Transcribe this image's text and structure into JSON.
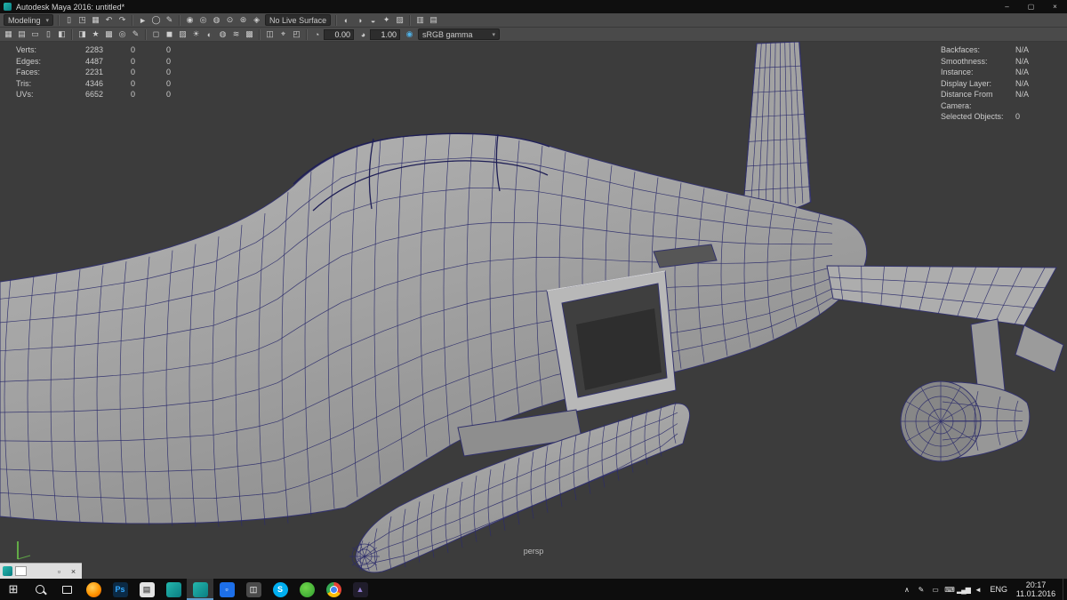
{
  "colors": {
    "maya_teal": "#14a09a",
    "viewport_bg": "#3c3c3c",
    "wireframe_blue": "#2b2b6a",
    "model_gray": "#a6a6a6",
    "chrome_bg": "#4a4a4a",
    "taskbar_bg": "#0d0d0d"
  },
  "glyphs": {
    "chevron_down": "▾"
  },
  "title_bar": {
    "title": "Autodesk Maya 2016: untitled*",
    "buttons": [
      {
        "name": "minimize-button",
        "glyph": "–"
      },
      {
        "name": "maximize-button",
        "glyph": "▢"
      },
      {
        "name": "close-button",
        "glyph": "×"
      }
    ]
  },
  "menubar": {
    "mode_selector": "Modeling",
    "live_surface": "No Live Surface",
    "file_icons": [
      {
        "name": "new-scene-icon",
        "glyph": "▯"
      },
      {
        "name": "open-scene-icon",
        "glyph": "◳"
      },
      {
        "name": "save-scene-icon",
        "glyph": "▦"
      }
    ],
    "history_icons": [
      {
        "name": "undo-icon",
        "glyph": "↶"
      },
      {
        "name": "redo-icon",
        "glyph": "↷"
      }
    ],
    "select_icons": [
      {
        "name": "select-tool-icon",
        "glyph": "►"
      },
      {
        "name": "lasso-select-icon",
        "glyph": "◯"
      },
      {
        "name": "paint-select-icon",
        "glyph": "✎"
      }
    ],
    "snap_icons": [
      {
        "name": "snap-to-grid-icon",
        "glyph": "◉"
      },
      {
        "name": "snap-to-curve-icon",
        "glyph": "◎"
      },
      {
        "name": "snap-to-point-icon",
        "glyph": "◍"
      },
      {
        "name": "snap-to-projected-center-icon",
        "glyph": "⊙"
      },
      {
        "name": "snap-to-view-plane-icon",
        "glyph": "⊛"
      },
      {
        "name": "make-object-live-icon",
        "glyph": "◈"
      }
    ],
    "render_icons": [
      {
        "name": "open-render-view-icon",
        "glyph": "◐"
      },
      {
        "name": "render-current-frame-icon",
        "glyph": "◑"
      },
      {
        "name": "ipr-render-icon",
        "glyph": "◒"
      },
      {
        "name": "render-settings-icon",
        "glyph": "✦"
      },
      {
        "name": "render-setup-icon",
        "glyph": "▨"
      }
    ],
    "panel_icons": [
      {
        "name": "toggle-panel-menus-icon",
        "glyph": "▥"
      },
      {
        "name": "toggle-toolbox-icon",
        "glyph": "▤"
      }
    ]
  },
  "toolbar2": {
    "display_icons": [
      {
        "name": "grid-toggle-icon",
        "glyph": "▦"
      },
      {
        "name": "heads-up-display-icon",
        "glyph": "▤"
      },
      {
        "name": "film-gate-icon",
        "glyph": "▭"
      },
      {
        "name": "resolution-gate-icon",
        "glyph": "▯"
      },
      {
        "name": "gate-mask-icon",
        "glyph": "◧"
      }
    ],
    "camera_icons": [
      {
        "name": "camera-attributes-icon",
        "glyph": "◨"
      },
      {
        "name": "bookmarks-icon",
        "glyph": "★"
      },
      {
        "name": "image-plane-icon",
        "glyph": "▩"
      },
      {
        "name": "pan-zoom-icon",
        "glyph": "◎"
      },
      {
        "name": "grease-pencil-icon",
        "glyph": "✎"
      }
    ],
    "shading_icons": [
      {
        "name": "wireframe-display-icon",
        "glyph": "◻"
      },
      {
        "name": "smooth-shade-icon",
        "glyph": "◼"
      },
      {
        "name": "textured-display-icon",
        "glyph": "▨"
      },
      {
        "name": "use-all-lights-icon",
        "glyph": "☀"
      },
      {
        "name": "shadows-icon",
        "glyph": "◐"
      },
      {
        "name": "screen-space-ao-icon",
        "glyph": "◍"
      },
      {
        "name": "motion-blur-icon",
        "glyph": "≋"
      },
      {
        "name": "anti-aliasing-icon",
        "glyph": "▩"
      }
    ],
    "isolate_icons": [
      {
        "name": "xray-display-icon",
        "glyph": "◫"
      },
      {
        "name": "xray-joints-icon",
        "glyph": "⌖"
      },
      {
        "name": "isolate-select-icon",
        "glyph": "◰"
      }
    ],
    "exposure_field": {
      "icon_glyph": "◔",
      "value": "0.00"
    },
    "gamma_field": {
      "icon_glyph": "◕",
      "value": "1.00"
    },
    "color_transform": {
      "icon_glyph": "◉",
      "label": "sRGB gamma"
    }
  },
  "hud_left": {
    "rows": [
      {
        "label": "Verts:",
        "v1": "2283",
        "v2": "0",
        "v3": "0"
      },
      {
        "label": "Edges:",
        "v1": "4487",
        "v2": "0",
        "v3": "0"
      },
      {
        "label": "Faces:",
        "v1": "2231",
        "v2": "0",
        "v3": "0"
      },
      {
        "label": "Tris:",
        "v1": "4346",
        "v2": "0",
        "v3": "0"
      },
      {
        "label": "UVs:",
        "v1": "6652",
        "v2": "0",
        "v3": "0"
      }
    ]
  },
  "hud_right": {
    "rows": [
      {
        "label": "Backfaces:",
        "value": "N/A"
      },
      {
        "label": "Smoothness:",
        "value": "N/A"
      },
      {
        "label": "Instance:",
        "value": "N/A"
      },
      {
        "label": "Display Layer:",
        "value": "N/A"
      },
      {
        "label": "Distance From Camera:",
        "value": "N/A"
      },
      {
        "label": "Selected Objects:",
        "value": "0"
      }
    ]
  },
  "viewport": {
    "camera_label": "persp"
  },
  "mini_window": {
    "buttons": [
      {
        "name": "panel-restore-button",
        "glyph": "▫"
      },
      {
        "name": "panel-close-button",
        "glyph": "×"
      }
    ]
  },
  "taskbar": {
    "apps": [
      {
        "name": "taskbar-firefox-icon",
        "cls": "circle",
        "bg": "radial-gradient(circle at 40% 35%, #ffcf5c, #ff9400 55%, #e66000 90%)"
      },
      {
        "name": "taskbar-photoshop-icon",
        "glyph": "Ps",
        "bg": "#0b2a45",
        "fg": "#31a8ff"
      },
      {
        "name": "taskbar-3dsmax-icon",
        "glyph": "▤",
        "bg": "#e4e4e4",
        "fg": "#666666"
      },
      {
        "name": "taskbar-maya-icon",
        "bg": "linear-gradient(135deg,#24b8ad,#0a7d82)"
      },
      {
        "name": "taskbar-maya-active-icon",
        "bg": "linear-gradient(135deg,#24b8ad,#0a7d82)",
        "rootcls": "active"
      },
      {
        "name": "taskbar-save-tool-icon",
        "glyph": "▫",
        "bg": "#1d6fe8",
        "fg": "#ffffff"
      },
      {
        "name": "taskbar-explorer-icon",
        "glyph": "◫",
        "bg": "#4a4a4a",
        "fg": "#d0d0d0"
      },
      {
        "name": "taskbar-skype-icon",
        "glyph": "S",
        "cls": "circle",
        "bg": "#00aff0",
        "fg": "#ffffff"
      },
      {
        "name": "taskbar-green-app-icon",
        "cls": "circle",
        "bg": "radial-gradient(circle at 40% 35%, #6fd44a, #2f9e2f)"
      },
      {
        "name": "taskbar-chrome-icon",
        "cls": "chrome"
      },
      {
        "name": "taskbar-photos-icon",
        "glyph": "▲",
        "bg": "#201d2b",
        "fg": "#8f7bd0"
      }
    ],
    "tray": [
      {
        "name": "hidden-icons-chevron",
        "glyph": "∧"
      },
      {
        "name": "tray-pen-icon",
        "glyph": "✎"
      },
      {
        "name": "tray-battery-icon",
        "glyph": "▭"
      },
      {
        "name": "tray-keyboard-icon",
        "glyph": "⌨"
      },
      {
        "name": "tray-network-icon",
        "glyph": "▂▄▆"
      },
      {
        "name": "tray-volume-icon",
        "glyph": "◄"
      }
    ],
    "language": "ENG",
    "clock": {
      "time": "20:17",
      "date": "11.01.2016"
    }
  }
}
